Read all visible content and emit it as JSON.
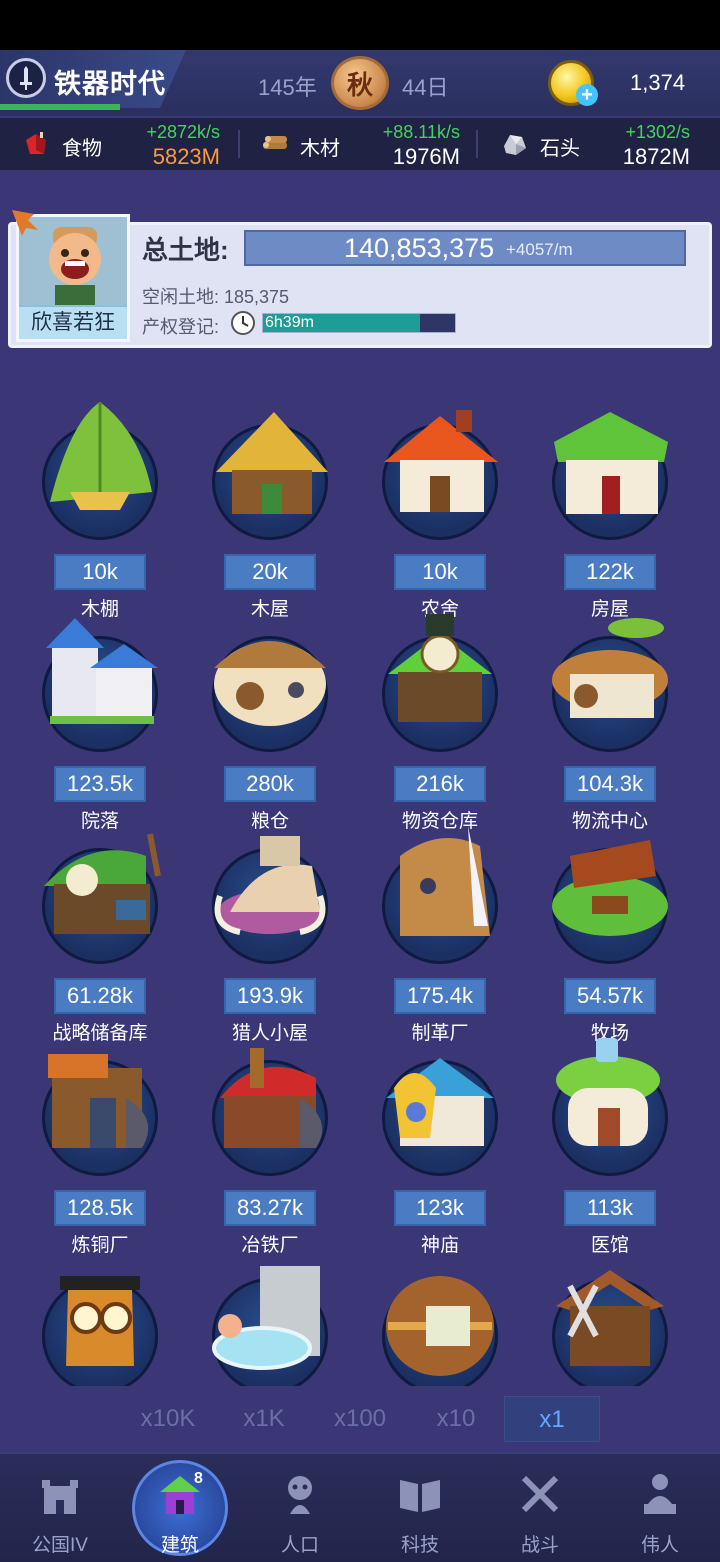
{
  "header": {
    "era_title": "铁器时代",
    "year": "145年",
    "season": "秋",
    "day": "44日",
    "coins": "1,374"
  },
  "resources": [
    {
      "label": "食物",
      "rate": "+2872k/s",
      "amount": "5823M",
      "amount_color": "#ff9a3c",
      "icon": "meat-icon"
    },
    {
      "label": "木材",
      "rate": "+88.11k/s",
      "amount": "1976M",
      "amount_color": "#ffffff",
      "icon": "wood-icon"
    },
    {
      "label": "石头",
      "rate": "+1302/s",
      "amount": "1872M",
      "amount_color": "#ffffff",
      "icon": "stone-icon"
    }
  ],
  "land": {
    "avatar_label": "欣喜若狂",
    "total_label": "总土地:",
    "total_value": "140,853,375",
    "total_rate": "+4057/m",
    "idle_land": "空闲土地: 185,375",
    "register_label": "产权登记:",
    "register_time": "6h39m",
    "register_progress": 0.82
  },
  "buildings": [
    {
      "cost": "10k",
      "name": "木棚"
    },
    {
      "cost": "20k",
      "name": "木屋"
    },
    {
      "cost": "10k",
      "name": "农舍"
    },
    {
      "cost": "122k",
      "name": "房屋"
    },
    {
      "cost": "123.5k",
      "name": "院落"
    },
    {
      "cost": "280k",
      "name": "粮仓"
    },
    {
      "cost": "216k",
      "name": "物资仓库"
    },
    {
      "cost": "104.3k",
      "name": "物流中心"
    },
    {
      "cost": "61.28k",
      "name": "战略储备库"
    },
    {
      "cost": "193.9k",
      "name": "猎人小屋"
    },
    {
      "cost": "175.4k",
      "name": "制革厂"
    },
    {
      "cost": "54.57k",
      "name": "牧场"
    },
    {
      "cost": "128.5k",
      "name": "炼铜厂"
    },
    {
      "cost": "83.27k",
      "name": "冶铁厂"
    },
    {
      "cost": "123k",
      "name": "神庙"
    },
    {
      "cost": "113k",
      "name": "医馆"
    }
  ],
  "multipliers": [
    {
      "label": "x10K",
      "active": false
    },
    {
      "label": "x1K",
      "active": false
    },
    {
      "label": "x100",
      "active": false
    },
    {
      "label": "x10",
      "active": false
    },
    {
      "label": "x1",
      "active": true
    }
  ],
  "nav": [
    {
      "label": "公国IV",
      "icon": "castle-icon",
      "active": false
    },
    {
      "label": "建筑",
      "icon": "house-icon",
      "active": true,
      "badge": "8"
    },
    {
      "label": "人口",
      "icon": "person-icon",
      "active": false
    },
    {
      "label": "科技",
      "icon": "book-icon",
      "active": false
    },
    {
      "label": "战斗",
      "icon": "swords-icon",
      "active": false
    },
    {
      "label": "伟人",
      "icon": "statue-icon",
      "active": false
    }
  ]
}
